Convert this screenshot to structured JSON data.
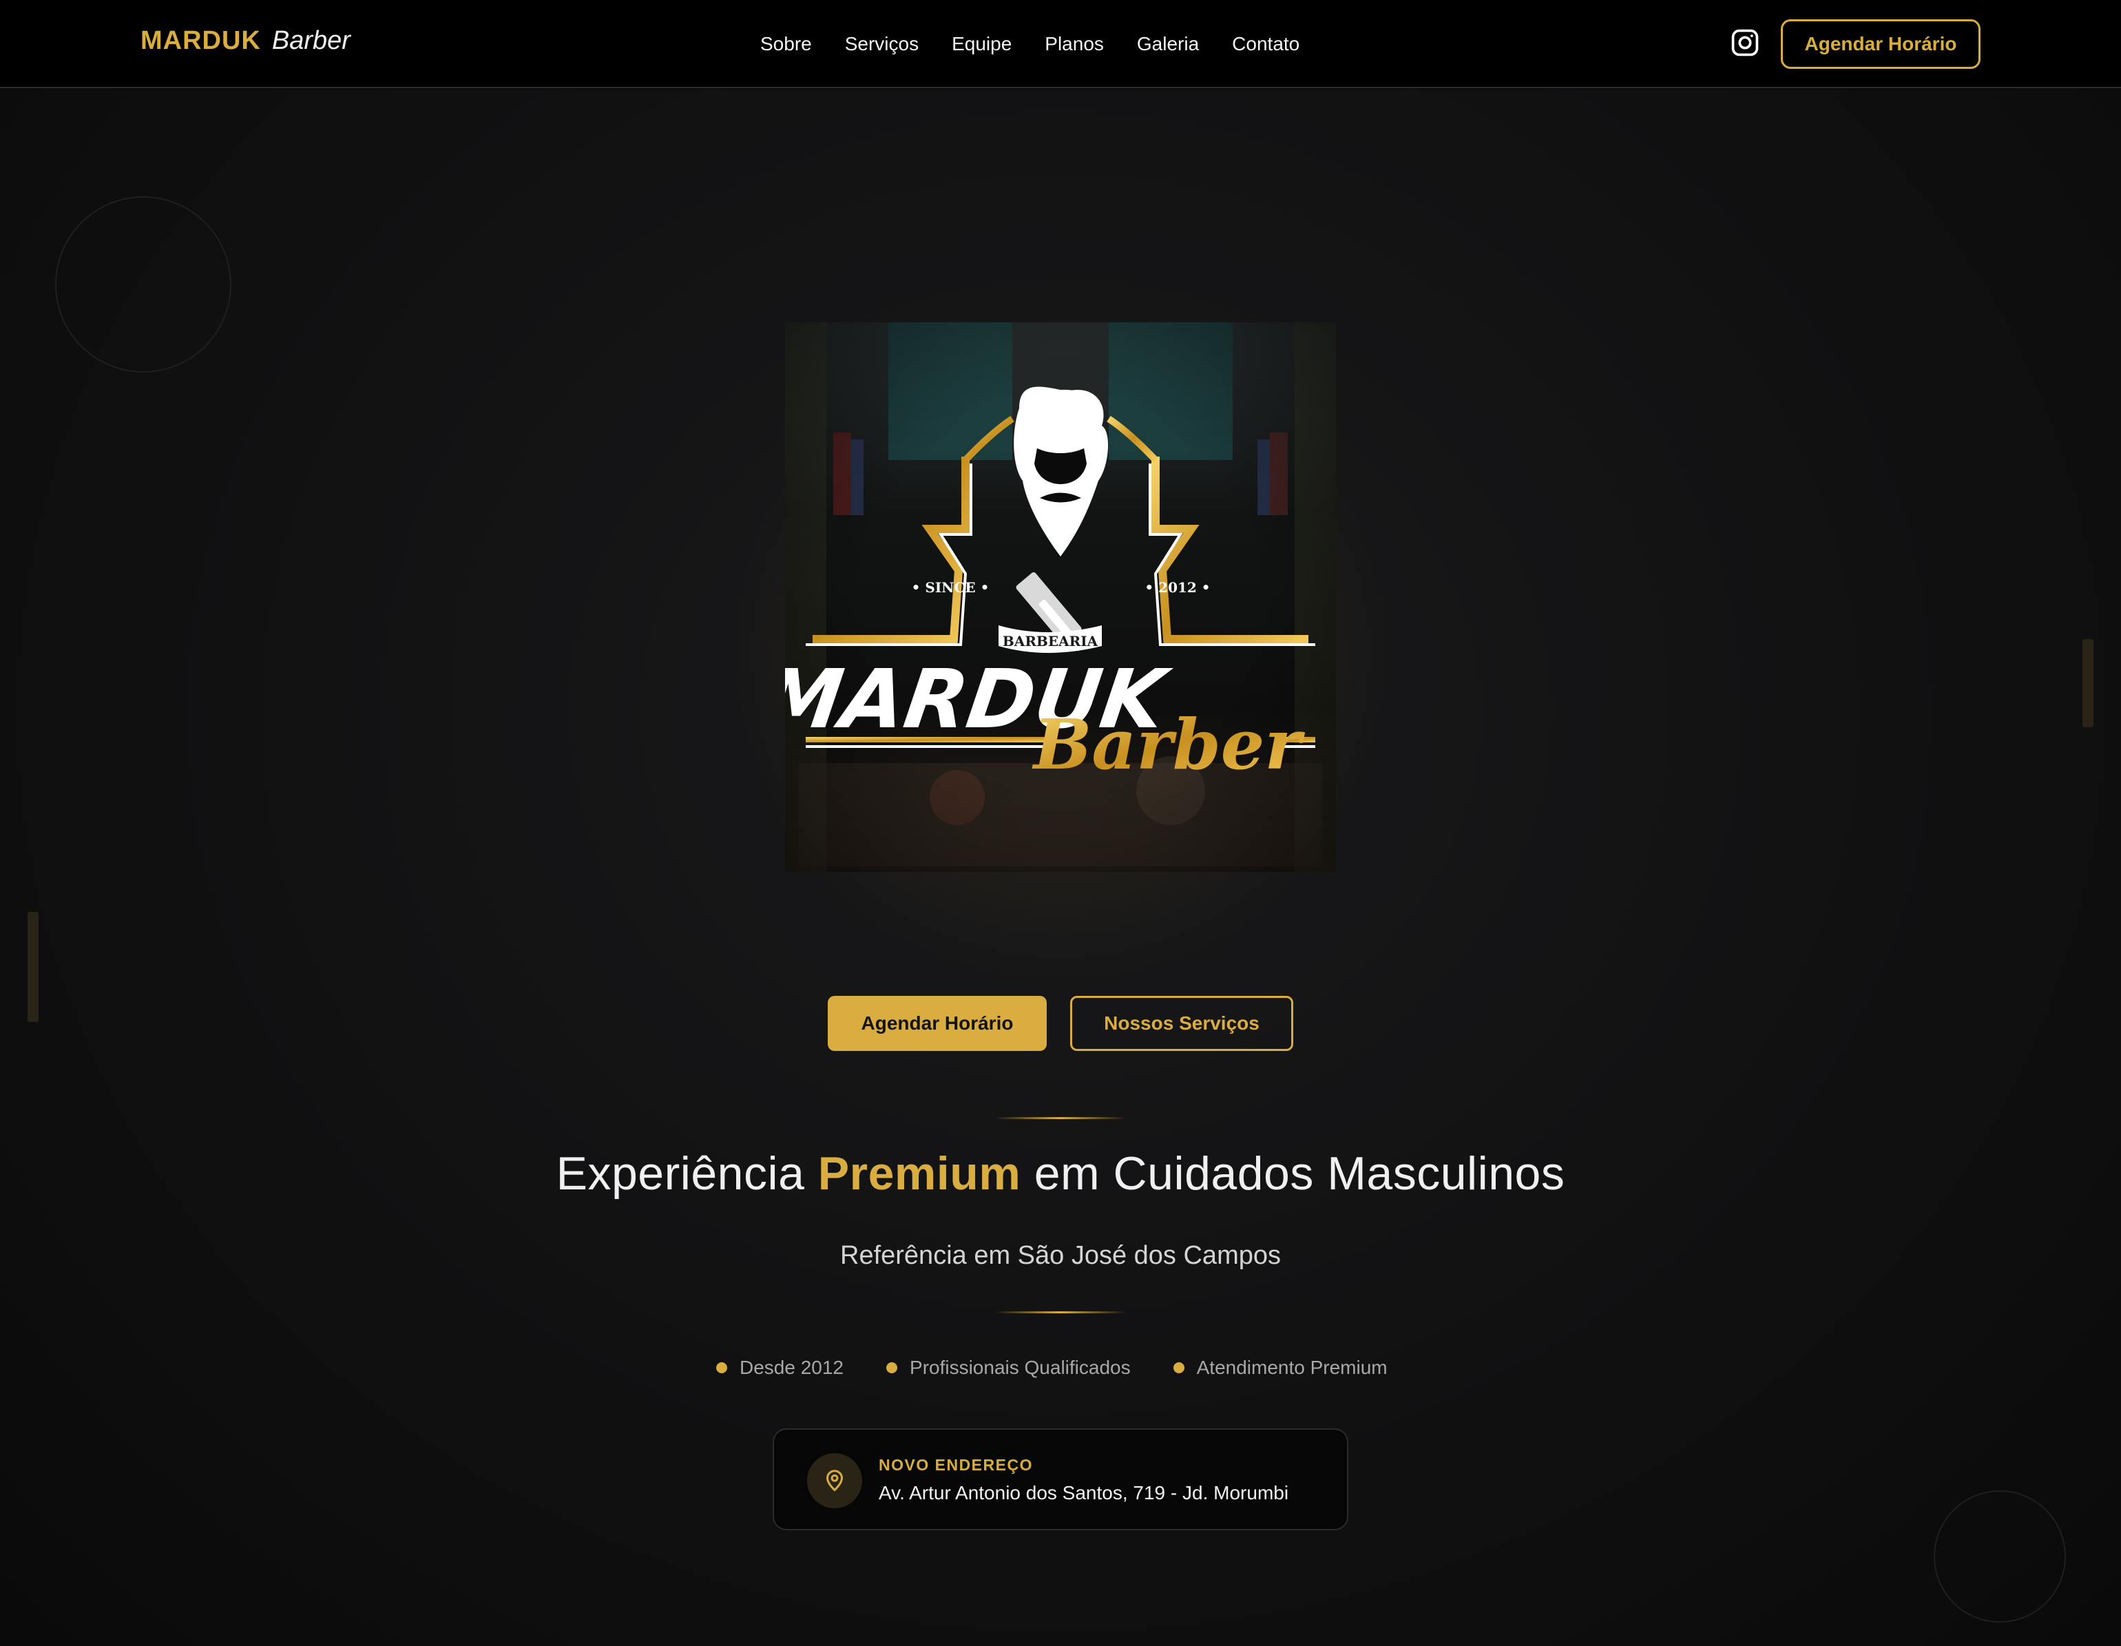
{
  "header": {
    "brand_name": "MARDUK",
    "brand_sub": "Barber",
    "nav": [
      "Sobre",
      "Serviços",
      "Equipe",
      "Planos",
      "Galeria",
      "Contato"
    ],
    "instagram_icon": "instagram-icon",
    "cta_label": "Agendar Horário"
  },
  "logo": {
    "since": "• SINCE •",
    "year": "• 2012 •",
    "ribbon": "BARBEARIA",
    "name": "MARDUK",
    "script": "Barber"
  },
  "hero": {
    "primary_button": "Agendar Horário",
    "secondary_button": "Nossos Serviços",
    "headline_pre": "Experiência ",
    "headline_accent": "Premium",
    "headline_post": " em Cuidados Masculinos",
    "subline": "Referência em São José dos Campos",
    "features": [
      "Desde 2012",
      "Profissionais Qualificados",
      "Atendimento Premium"
    ]
  },
  "address": {
    "icon": "map-pin-icon",
    "label": "NOVO ENDEREÇO",
    "text": "Av. Artur Antonio dos Santos, 719 - Jd. Morumbi"
  },
  "colors": {
    "accent": "#d9ad3f",
    "background": "#0c0c0d",
    "header_bg": "#000000"
  }
}
